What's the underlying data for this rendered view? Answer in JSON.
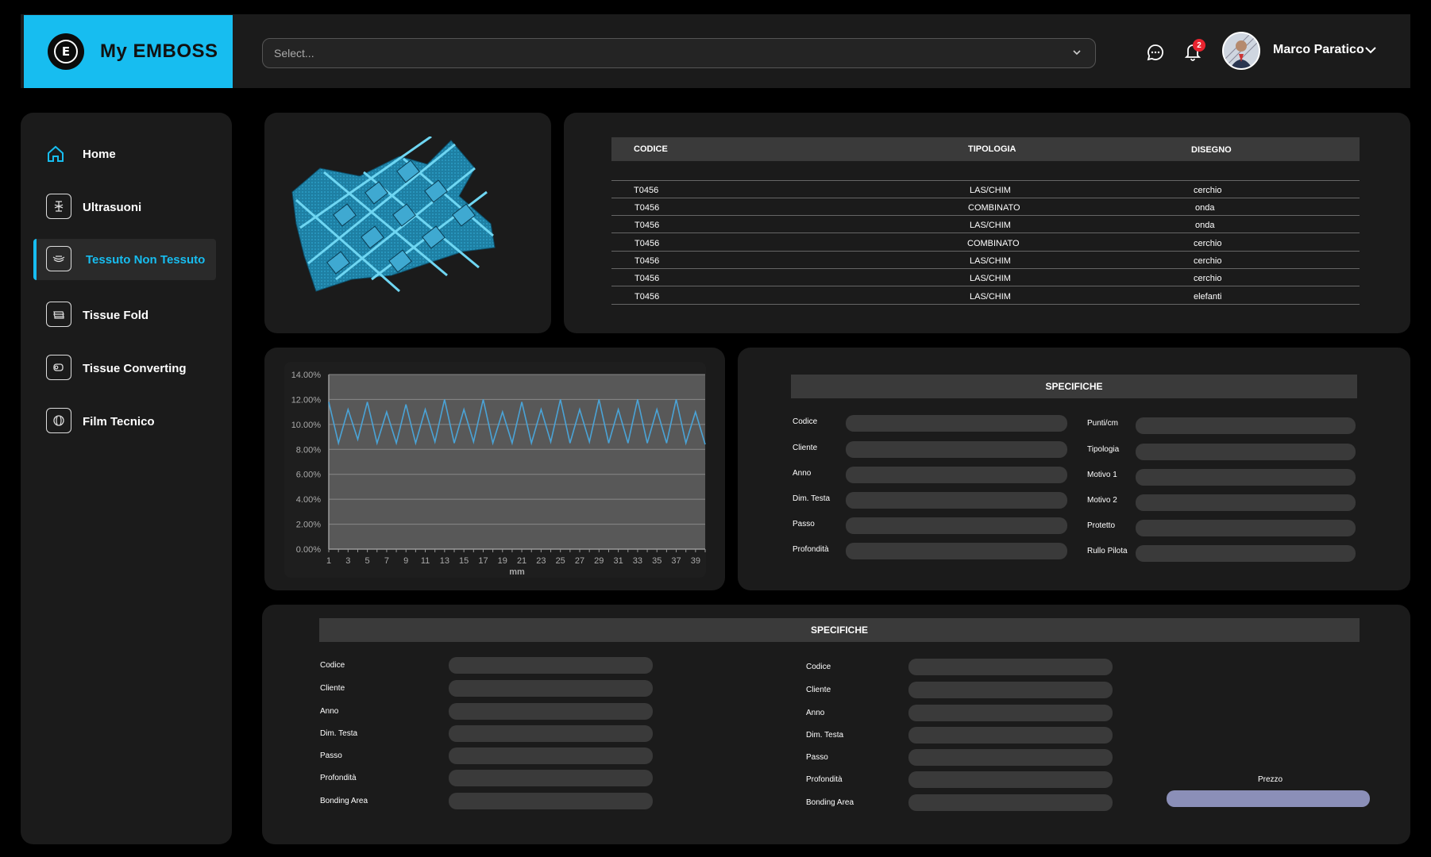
{
  "brand": {
    "name": "My EMBOSS",
    "logo_letter": "E"
  },
  "header": {
    "select_placeholder": "Select...",
    "notification_count": "2",
    "user_name": "Marco Paratico"
  },
  "sidebar": {
    "items": [
      {
        "label": "Home",
        "icon": "home-icon"
      },
      {
        "label": "Ultrasuoni",
        "icon": "ultrasound-icon"
      },
      {
        "label": "Tessuto Non Tessuto",
        "icon": "nonwoven-icon"
      },
      {
        "label": "Tissue Fold",
        "icon": "tissue-fold-icon"
      },
      {
        "label": "Tissue Converting",
        "icon": "tissue-roll-icon"
      },
      {
        "label": "Film Tecnico",
        "icon": "film-icon"
      }
    ],
    "active_index": 2
  },
  "table": {
    "headers": [
      "CODICE",
      "TIPOLOGIA",
      "DISEGNO"
    ],
    "rows": [
      [
        "T0456",
        "LAS/CHIM",
        "cerchio"
      ],
      [
        "T0456",
        "COMBINATO",
        "onda"
      ],
      [
        "T0456",
        "LAS/CHIM",
        "onda"
      ],
      [
        "T0456",
        "COMBINATO",
        "cerchio"
      ],
      [
        "T0456",
        "LAS/CHIM",
        "cerchio"
      ],
      [
        "T0456",
        "LAS/CHIM",
        "cerchio"
      ],
      [
        "T0456",
        "LAS/CHIM",
        "elefanti"
      ]
    ]
  },
  "specs_right": {
    "title": "SPECIFICHE",
    "left_labels": [
      "Codice",
      "Cliente",
      "Anno",
      "Dim. Testa",
      "Passo",
      "Profondità"
    ],
    "right_labels": [
      "Punti/cm",
      "Tipologia",
      "Motivo 1",
      "Motivo 2",
      "Protetto",
      "Rullo Pilota"
    ]
  },
  "specs_bottom": {
    "title": "SPECIFICHE",
    "left_labels": [
      "Codice",
      "Cliente",
      "Anno",
      "Dim. Testa",
      "Passo",
      "Profondità",
      "Bonding Area"
    ],
    "right_labels": [
      "Codice",
      "Cliente",
      "Anno",
      "Dim. Testa",
      "Passo",
      "Profondità",
      "Bonding Area"
    ],
    "price_label": "Prezzo"
  },
  "colors": {
    "accent": "#17bdf0",
    "line": "#4aa3d6",
    "price_bar": "#8b8fb8"
  },
  "chart_data": {
    "type": "line",
    "xlabel": "mm",
    "ylabel": "",
    "y_ticks": [
      "0.00%",
      "2.00%",
      "4.00%",
      "6.00%",
      "8.00%",
      "10.00%",
      "12.00%",
      "14.00%"
    ],
    "x_ticks": [
      "1",
      "3",
      "5",
      "7",
      "9",
      "11",
      "13",
      "15",
      "17",
      "19",
      "21",
      "23",
      "25",
      "27",
      "29",
      "31",
      "33",
      "35",
      "37",
      "39"
    ],
    "ylim": [
      0,
      14
    ],
    "xlim": [
      1,
      40
    ],
    "x": [
      1,
      2,
      3,
      4,
      5,
      6,
      7,
      8,
      9,
      10,
      11,
      12,
      13,
      14,
      15,
      16,
      17,
      18,
      19,
      20,
      21,
      22,
      23,
      24,
      25,
      26,
      27,
      28,
      29,
      30,
      31,
      32,
      33,
      35,
      36,
      37,
      38,
      39,
      40
    ],
    "values": [
      11.8,
      8.5,
      11.2,
      8.8,
      11.8,
      8.5,
      11.0,
      8.5,
      11.6,
      8.5,
      11.2,
      8.6,
      12.0,
      8.5,
      11.2,
      8.6,
      12.0,
      8.5,
      11.0,
      8.5,
      11.8,
      8.5,
      11.2,
      8.6,
      12.0,
      8.5,
      11.2,
      8.6,
      12.0,
      8.5,
      11.2,
      8.5,
      12.0,
      8.5,
      11.2,
      8.5,
      12.0,
      8.5,
      11.0,
      8.4
    ]
  }
}
